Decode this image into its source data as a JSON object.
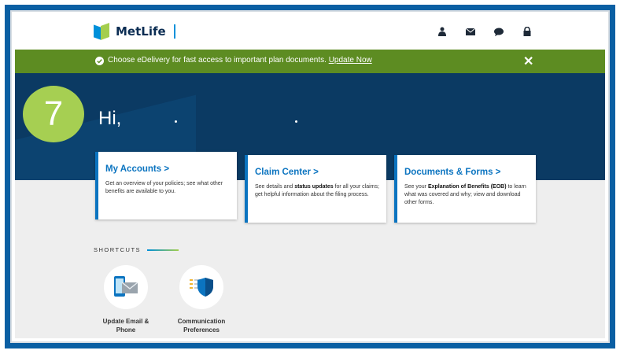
{
  "header": {
    "brand": "MetLife",
    "icons": [
      "user-icon",
      "mail-icon",
      "chat-icon",
      "lock-icon"
    ]
  },
  "banner": {
    "message": "Choose eDelivery for fast access to important plan documents.",
    "link": "Update Now",
    "close": "✕"
  },
  "hero": {
    "step_number": "7",
    "greeting": "Hi,"
  },
  "cards": [
    {
      "title": "My Accounts  >",
      "desc_pre": "Get an overview of your policies; see what other benefits are available to you.",
      "desc_bold": "",
      "desc_post": ""
    },
    {
      "title": "Claim Center  >",
      "desc_pre": "See details and ",
      "desc_bold": "status updates",
      "desc_post": " for all your claims; get helpful information about the filing process."
    },
    {
      "title": "Documents & Forms  >",
      "desc_pre": "See your ",
      "desc_bold": "Explanation of Benefits (EOB)",
      "desc_post": " to learn what was covered and why; view and download other forms."
    }
  ],
  "shortcuts": {
    "label": "SHORTCUTS",
    "items": [
      {
        "label_line1": "Update Email &",
        "label_line2": "Phone",
        "icon": "phone-mail-icon"
      },
      {
        "label_line1": "Communication",
        "label_line2": "Preferences",
        "icon": "shield-list-icon"
      }
    ]
  },
  "colors": {
    "frame": "#0a5fa3",
    "banner": "#5d8c22",
    "hero": "#0b3a63",
    "accent": "#0b74c0",
    "badge": "#a6cf52"
  }
}
